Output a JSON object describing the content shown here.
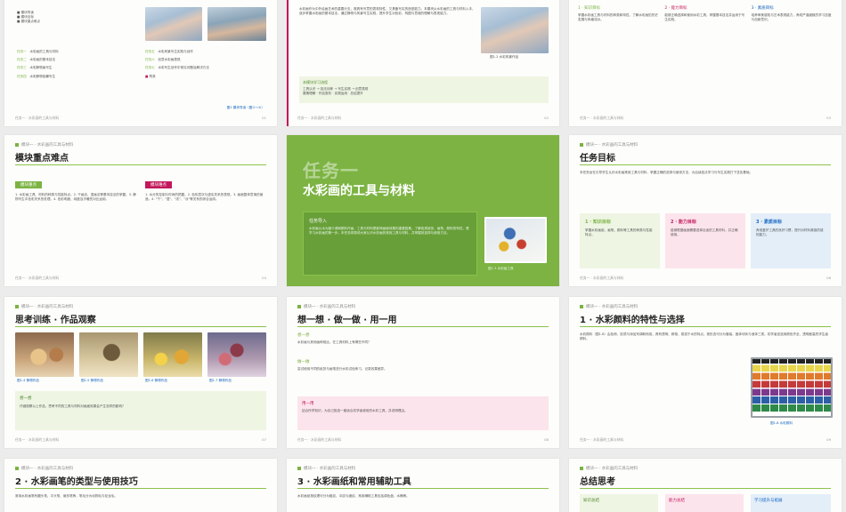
{
  "colors": {
    "accent": "#7cb342",
    "pink": "#c2185b",
    "blue": "#1565c0"
  },
  "common": {
    "chapter": "模块一 · 水彩画的工具与材料",
    "foot_left": "任务一 · 水彩画的工具与材料",
    "page_nums": [
      "01",
      "02",
      "03",
      "04",
      "05",
      "06",
      "07",
      "08",
      "09",
      "10",
      "11",
      "12"
    ]
  },
  "s0": {
    "bullets": [
      "模块导读",
      "模块目标",
      "模块重点难点"
    ],
    "tasks_left": [
      {
        "k": "任务一",
        "v": "水彩画的工具与材料"
      },
      {
        "k": "任务二",
        "v": "水彩画的基本技法"
      },
      {
        "k": "任务三",
        "v": "水彩静物画写生"
      },
      {
        "k": "任务四",
        "v": "水彩静物临摹写生"
      }
    ],
    "tasks_right": [
      {
        "k": "任务五",
        "v": "水彩风景写生实践与创作"
      },
      {
        "k": "任务六",
        "v": "创意水彩画表现"
      },
      {
        "k": "任务七",
        "v": "水彩写生创作中常见问题及解决方法"
      },
      {
        "k": "",
        "v": "附录"
      }
    ],
    "caption": "图1  模块导读（图①～④）"
  },
  "s1": {
    "para": "水彩画作为中外绘画艺术的重要分支，既具有写意的表现特性，又具备写实的造型能力。本模块从水彩画的工具与材料入手，逐步掌握水彩画的基本技法，通过静物与风景写生实践，提升学生对色彩、构图与意境的理解与表现能力。",
    "caption": "图1-2  水彩风景作品",
    "flow_title": "本模块学习流程",
    "flow1": "工具认识 → 技法训练 → 写生实践 → 创意表现",
    "flow2": "要素理解 · 作品赏析 · 实践运用 · 总结提升"
  },
  "s2": {
    "cols": [
      {
        "t": "1 · 知识目标",
        "txt": "掌握水彩画工具与材料的种类和特性，了解水彩画的历史发展与风格流派。"
      },
      {
        "t": "2 · 能力目标",
        "txt": "能够正确选择和使用水彩工具，掌握基本技法并运用于写生实践。"
      },
      {
        "t": "3 · 素质目标",
        "txt": "培养审美感知与艺术表现能力，养成严谨细致的学习态度与创新意识。"
      }
    ]
  },
  "s3": {
    "title": "模块重点难点",
    "tag_key": "模块重点",
    "tag_diff": "模块难点",
    "key_txt": "1. 水彩画工具、材料的种类与性能特点。2. 干画法、湿画法等基本技法的掌握。3. 静物写生中色彩关系的处理。4. 色彩明度、纯度及冷暖的对比运用。",
    "diff_txt": "1. 水分的控制与时间的把握。2. 色彩层次与虚实关系的表现。3. 画面整体意境的营造。4. \"干\"、\"湿\"、\"浓\"、\"淡\"等关系的综合运用。"
  },
  "s4": {
    "big": "任务一",
    "sub": "水彩画的工具与材料",
    "box_title": "任务导入",
    "box_txt": "水彩画以水为媒介调和颜料作画，工具与材料是影响画面效果的重要因素。了解各类纸张、画笔、颜料的特性，是学习水彩画的第一步。本任务将带领大家认识水彩画的常用工具与材料，并掌握其选择与使用方法。",
    "caption": "图1-3  水彩画工具"
  },
  "s5": {
    "title": "任务目标",
    "intro": "本任务旨在引导学生认识水彩画常用工具与材料，掌握正确的选择与使用方法，为后续技法学习与写生实践打下坚实基础。",
    "cards": [
      {
        "t": "1 · 知识目标",
        "txt": "掌握水彩画纸、画笔、颜料等工具的种类与性能特点。"
      },
      {
        "t": "2 · 能力目标",
        "txt": "能够根据画面需要选择合适的工具材料，并正确使用。"
      },
      {
        "t": "3 · 素质目标",
        "txt": "养成爱护工具的良好习惯，提升对材料美感的感知能力。"
      }
    ]
  },
  "s6": {
    "title": "思考训练 · 作品观察",
    "caps": [
      "图1-4  静物作品",
      "图1-5  静物作品",
      "图1-6  静物作品",
      "图1-7  静物作品"
    ],
    "box_title": "想一想",
    "box_txt": "仔细观察以上作品，思考不同的工具与材料对画面效果会产生怎样的影响？"
  },
  "s7": {
    "title": "想一想 · 做一做 · 用一用",
    "q1t": "想一想",
    "q1": "水彩画与其他画种相比，在工具材料上有哪些不同？",
    "q2t": "做一做",
    "q2": "尝试使用不同的纸张与画笔进行水彩试色练习，记录效果差异。",
    "q3t": "用一用",
    "q3": "结合所学知识，为自己挑选一套适合初学者使用的水彩工具，并说明理由。"
  },
  "s8": {
    "title": "1 · 水彩颜料的特性与选择",
    "para": "水彩颜料（图1-8）由色粉、胶质与添加剂调和而成，具有透明、鲜艳、易溶于水的特点。按形态可分为管装、固体块状与液体三类。初学者宜选用颜色齐全、透明度高的学生级颜料。",
    "caption": "图1-8  水彩颜料"
  },
  "s9": {
    "title": "2 · 水彩画笔的类型与使用技巧",
    "para": "常用水彩画笔有圆头笔、平头笔、扇形笔等，笔毛分为动物毛与尼龙毛。"
  },
  "s10": {
    "title": "3 · 水彩画纸和常用辅助工具",
    "para": "水彩画纸按纹理可分为粗纹、中纹与细纹，常用辅助工具包括调色盘、水桶等。"
  },
  "s11": {
    "title": "总结思考",
    "cards": [
      "知识总结",
      "能力总结",
      "学习提升与拓展"
    ]
  }
}
